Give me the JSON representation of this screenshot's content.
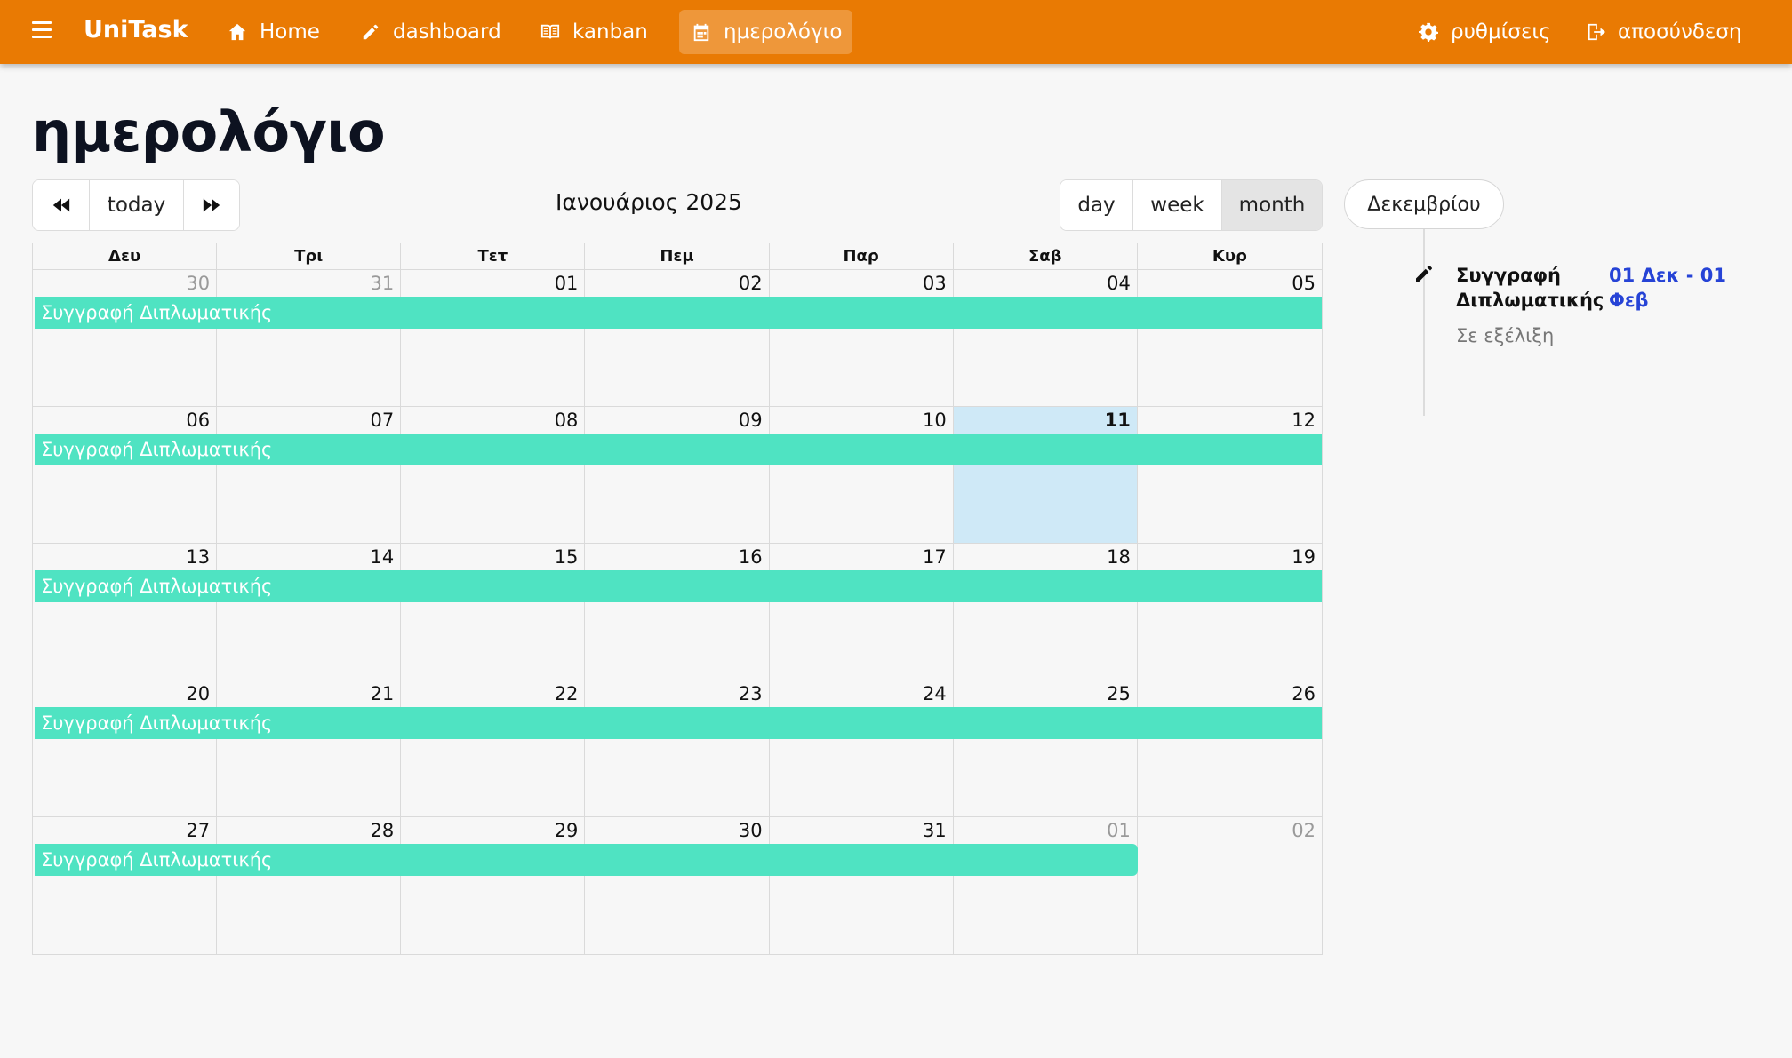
{
  "brand": "UniTask",
  "colors": {
    "navbar": "#e97a03",
    "event": "#4fe3c2",
    "today": "#cfe9f7",
    "link_date": "#2643d6"
  },
  "nav": {
    "home": {
      "label": "Home",
      "icon": "home-icon"
    },
    "dashboard": {
      "label": "dashboard",
      "icon": "pencil-icon"
    },
    "kanban": {
      "label": "kanban",
      "icon": "book-icon"
    },
    "calendar": {
      "label": "ημερολόγιο",
      "icon": "calendar-icon"
    },
    "settings": {
      "label": "ρυθμίσεις",
      "icon": "gear-icon"
    },
    "logout": {
      "label": "αποσύνδεση",
      "icon": "logout-icon"
    }
  },
  "page_title": "ημερολόγιο",
  "toolbar": {
    "prev_icon": "double-left-icon",
    "today": "today",
    "next_icon": "double-right-icon",
    "title": "Ιανουάριος 2025",
    "views": [
      "day",
      "week",
      "month"
    ],
    "active_view": "month"
  },
  "calendar": {
    "weekdays": [
      "Δευ",
      "Τρι",
      "Τετ",
      "Πεμ",
      "Παρ",
      "Σαβ",
      "Κυρ"
    ],
    "weeks": [
      {
        "days": [
          {
            "n": "30",
            "other": true
          },
          {
            "n": "31",
            "other": true
          },
          {
            "n": "01"
          },
          {
            "n": "02"
          },
          {
            "n": "03"
          },
          {
            "n": "04"
          },
          {
            "n": "05"
          }
        ],
        "event": {
          "title": "Συγγραφή Διπλωματικής",
          "span_days": 7,
          "ends": false
        }
      },
      {
        "days": [
          {
            "n": "06"
          },
          {
            "n": "07"
          },
          {
            "n": "08"
          },
          {
            "n": "09"
          },
          {
            "n": "10"
          },
          {
            "n": "11",
            "today": true
          },
          {
            "n": "12"
          }
        ],
        "event": {
          "title": "Συγγραφή Διπλωματικής",
          "span_days": 7,
          "ends": false
        }
      },
      {
        "days": [
          {
            "n": "13"
          },
          {
            "n": "14"
          },
          {
            "n": "15"
          },
          {
            "n": "16"
          },
          {
            "n": "17"
          },
          {
            "n": "18"
          },
          {
            "n": "19"
          }
        ],
        "event": {
          "title": "Συγγραφή Διπλωματικής",
          "span_days": 7,
          "ends": false
        }
      },
      {
        "days": [
          {
            "n": "20"
          },
          {
            "n": "21"
          },
          {
            "n": "22"
          },
          {
            "n": "23"
          },
          {
            "n": "24"
          },
          {
            "n": "25"
          },
          {
            "n": "26"
          }
        ],
        "event": {
          "title": "Συγγραφή Διπλωματικής",
          "span_days": 7,
          "ends": false
        }
      },
      {
        "days": [
          {
            "n": "27"
          },
          {
            "n": "28"
          },
          {
            "n": "29"
          },
          {
            "n": "30"
          },
          {
            "n": "31"
          },
          {
            "n": "01",
            "other": true
          },
          {
            "n": "02",
            "other": true
          }
        ],
        "event": {
          "title": "Συγγραφή Διπλωματικής",
          "span_days": 6,
          "ends": true
        }
      }
    ]
  },
  "sidebar": {
    "month_button": "Δεκεμβρίου",
    "item": {
      "icon": "pencil-icon",
      "title": "Συγγραφή Διπλωματικής",
      "date": "01 Δεκ - 01 Φεβ",
      "status": "Σε εξέλιξη"
    }
  }
}
